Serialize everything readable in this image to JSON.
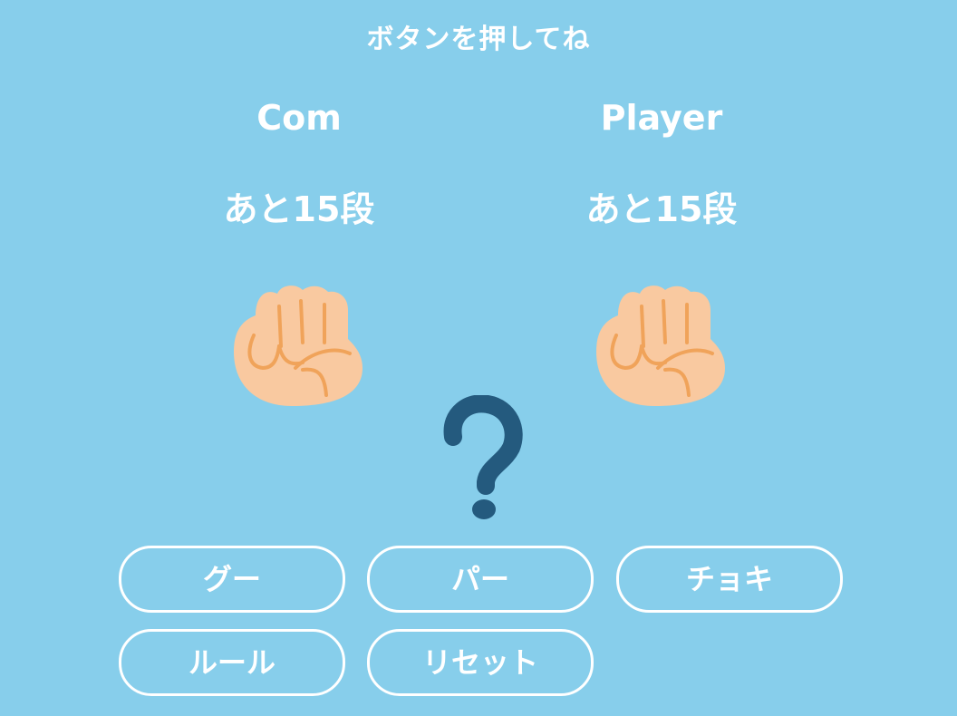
{
  "header": {
    "instruction": "ボタンを押してね"
  },
  "com": {
    "name": "Com",
    "remaining": "あと15段",
    "hand": "rock-fist-icon"
  },
  "player": {
    "name": "Player",
    "remaining": "あと15段",
    "hand": "rock-fist-icon"
  },
  "result": {
    "icon": "question-mark-icon"
  },
  "controls": {
    "gu": "グー",
    "pa": "パー",
    "choki": "チョキ",
    "rule": "ルール",
    "reset": "リセット"
  },
  "colors": {
    "background": "#87ceeb",
    "text": "#ffffff",
    "skin": "#f9c9a0",
    "skin_line": "#f0a35a",
    "question": "#245a7e"
  }
}
